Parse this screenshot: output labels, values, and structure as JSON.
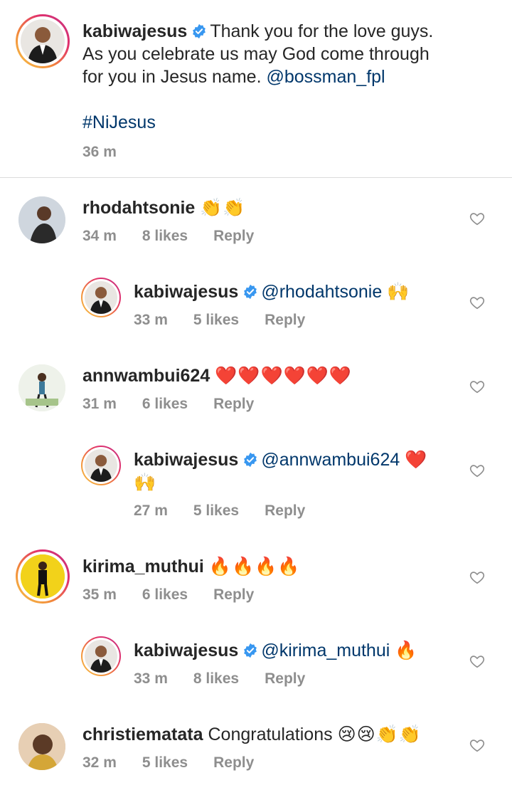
{
  "caption": {
    "username": "kabiwajesus",
    "text_line1": "Thank you for the love guys.",
    "text_line2": "As you celebrate us may God come through",
    "text_line3": "for you in Jesus name.",
    "mention": "@bossman_fpl",
    "hashtag": "#NiJesus",
    "time": "36 m"
  },
  "comments": [
    {
      "username": "rhodahtsonie",
      "text": "",
      "emoji": "👏👏",
      "time": "34 m",
      "likes": "8 likes",
      "reply": "Reply"
    },
    {
      "username": "kabiwajesus",
      "mention": "@rhodahtsonie",
      "emoji": "🙌",
      "time": "33 m",
      "likes": "5 likes",
      "reply": "Reply"
    },
    {
      "username": "annwambui624",
      "text": "",
      "emoji": "❤️❤️❤️❤️❤️❤️",
      "time": "31 m",
      "likes": "6 likes",
      "reply": "Reply"
    },
    {
      "username": "kabiwajesus",
      "mention": "@annwambui624",
      "emoji": "❤️",
      "emoji_line2": "🙌",
      "time": "27 m",
      "likes": "5 likes",
      "reply": "Reply"
    },
    {
      "username": "kirima_muthui",
      "text": "",
      "emoji": "🔥🔥🔥🔥",
      "time": "35 m",
      "likes": "6 likes",
      "reply": "Reply"
    },
    {
      "username": "kabiwajesus",
      "mention": "@kirima_muthui",
      "emoji": "🔥",
      "time": "33 m",
      "likes": "8 likes",
      "reply": "Reply"
    },
    {
      "username": "christiematata",
      "text": "Congratulations",
      "emoji": "😢😢👏👏",
      "time": "32 m",
      "likes": "5 likes",
      "reply": "Reply"
    }
  ],
  "colors": {
    "mention": "#00376b",
    "verified": "#3897f0",
    "meta_text": "#8e8e8e"
  }
}
